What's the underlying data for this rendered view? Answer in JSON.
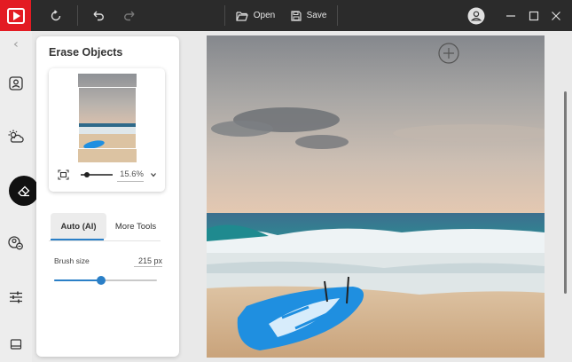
{
  "app": {
    "logo": "play-logo-icon"
  },
  "toolbar": {
    "open_label": "Open",
    "save_label": "Save",
    "icons": [
      "refresh-icon",
      "undo-icon",
      "redo-icon",
      "folder-open-icon",
      "save-icon"
    ]
  },
  "window": {
    "icons": [
      "account-icon",
      "minimize-icon",
      "maximize-icon",
      "close-icon"
    ]
  },
  "rail": {
    "items": [
      "collapse-chevron-icon",
      "portrait-icon",
      "sky-weather-icon",
      "eraser-icon",
      "face-retouch-icon",
      "adjustments-icon",
      "panel-layout-icon"
    ],
    "active": "eraser-icon"
  },
  "panel": {
    "title": "Erase Objects",
    "zoom": {
      "value": "15.6%",
      "level": 0.2
    },
    "tabs": [
      {
        "label": "Auto (AI)",
        "active": true
      },
      {
        "label": "More Tools",
        "active": false
      }
    ],
    "brush": {
      "label": "Brush size",
      "value": "215 px",
      "level": 0.46
    }
  },
  "colors": {
    "accent": "#2a7fc7",
    "brand": "#e31b23",
    "topbar": "#2b2b2b",
    "boat": "#1f8fe0"
  }
}
